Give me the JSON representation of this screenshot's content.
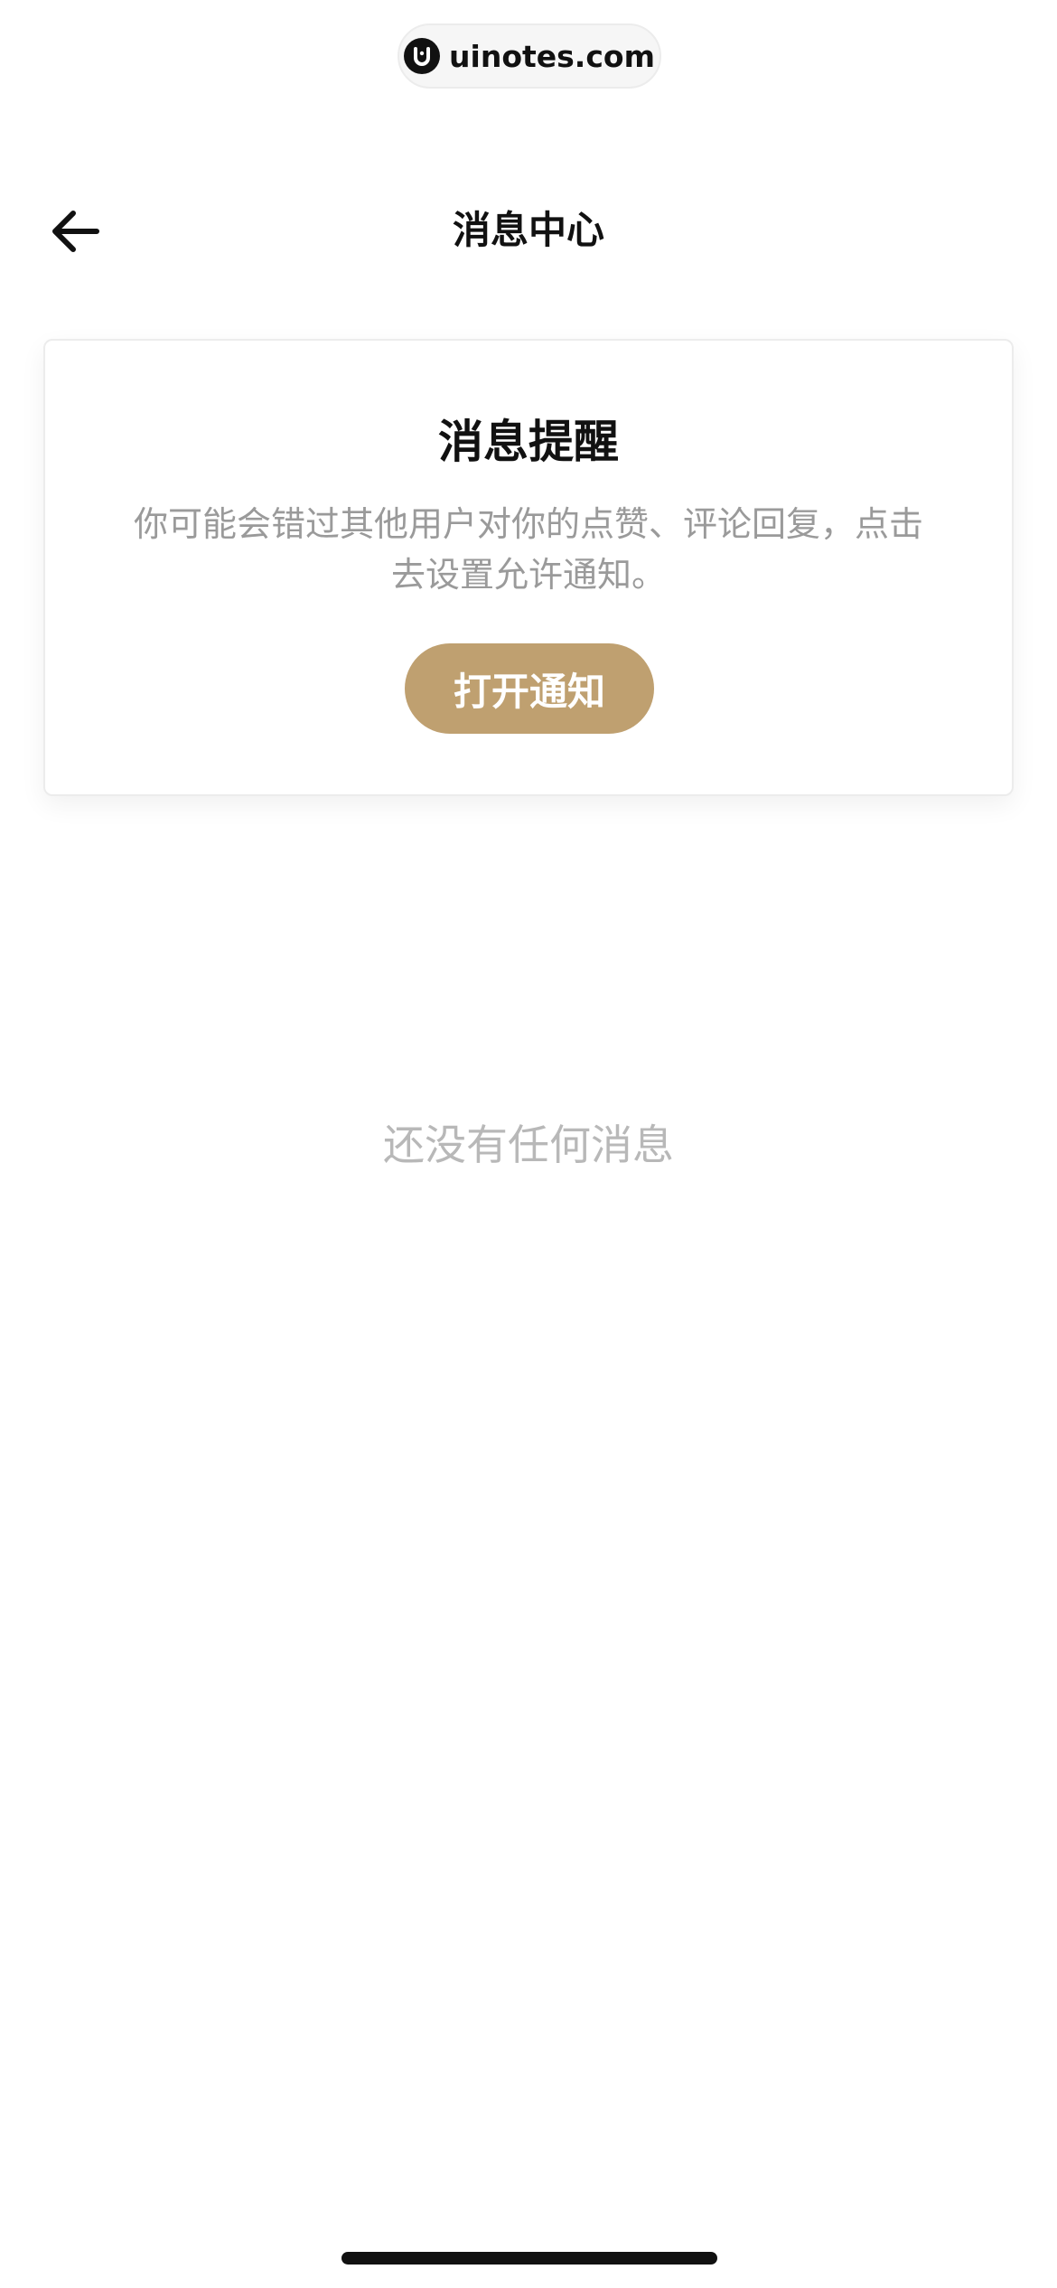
{
  "watermark": {
    "site": "uinotes.com",
    "icon": "uinotes-logo-icon"
  },
  "nav": {
    "back_icon": "arrow-left-icon",
    "title": "消息中心"
  },
  "notice_card": {
    "title": "消息提醒",
    "description": "你可能会错过其他用户对你的点赞、评论回复，点击去设置允许通知。",
    "button_label": "打开通知",
    "accent_color": "#bfa070"
  },
  "empty_state": {
    "text": "还没有任何消息"
  }
}
